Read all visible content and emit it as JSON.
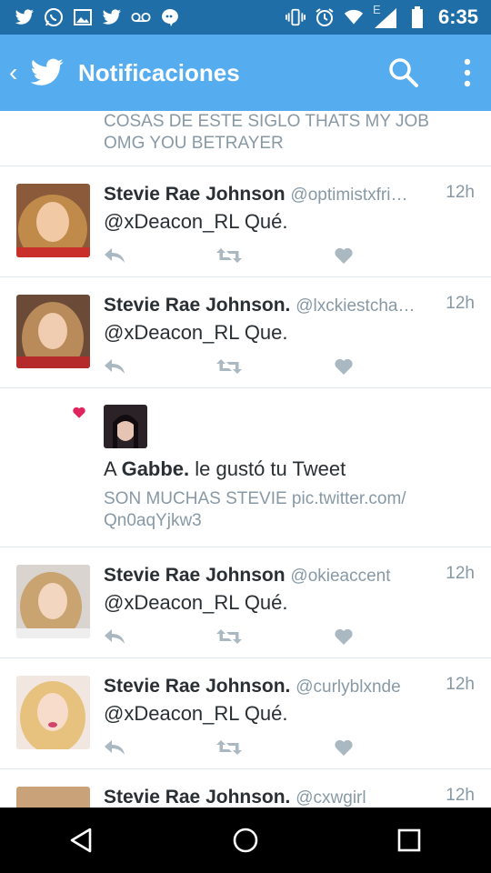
{
  "status_bar": {
    "time": "6:35",
    "network_label": "E",
    "icons": [
      "twitter-icon",
      "whatsapp-icon",
      "image-icon",
      "twitter-icon",
      "voicemail-icon",
      "chat-icon",
      "vibrate-icon",
      "alarm-icon",
      "wifi-icon",
      "signal-icon",
      "battery-icon"
    ]
  },
  "app_bar": {
    "title": "Notificaciones",
    "accent": "#55acee",
    "status_color": "#1f6ea8"
  },
  "partial_tweet": {
    "text_line1": "COSAS DE ESTE SIGLO THATS MY JOB",
    "text_line2": "OMG YOU BETRAYER"
  },
  "tweets_top": [
    {
      "author": "Stevie Rae Johnson",
      "handle": "@optimistxfri…",
      "time": "12h",
      "text": "@xDeacon_RL Qué."
    },
    {
      "author": "Stevie Rae Johnson.",
      "handle": "@lxckiestcha…",
      "time": "12h",
      "text": "@xDeacon_RL Que."
    }
  ],
  "like_notification": {
    "prefix": "A ",
    "user": "Gabbe.",
    "suffix": " le gustó tu Tweet",
    "quote_line1": "SON MUCHAS STEVIE pic.twitter.com/",
    "quote_line2": "Qn0aqYjkw3",
    "heart_color": "#e0245e"
  },
  "tweets_bottom": [
    {
      "author": "Stevie Rae Johnson",
      "handle": "@okieaccent",
      "time": "12h",
      "text": "@xDeacon_RL Qué."
    },
    {
      "author": "Stevie Rae Johnson.",
      "handle": "@curlyblxnde",
      "time": "12h",
      "text": "@xDeacon_RL Qué."
    },
    {
      "author": "Stevie Rae Johnson.",
      "handle": "@cxwgirl",
      "time": "12h",
      "text": ""
    }
  ],
  "nav_bar": {
    "buttons": [
      "back-icon",
      "home-icon",
      "recents-icon"
    ]
  }
}
